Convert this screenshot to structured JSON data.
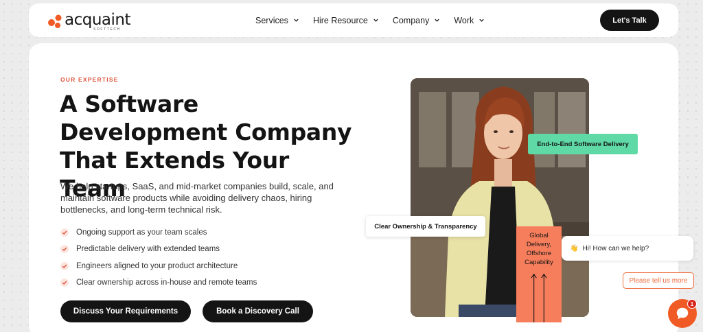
{
  "brand": {
    "name": "acquaint",
    "sub": "SOFTTECH",
    "colors": {
      "accent": "#f05a24",
      "dark": "#141414",
      "green": "#5fd9a6",
      "orange": "#f77e5c"
    }
  },
  "nav": {
    "items": [
      {
        "label": "Services",
        "icon": "chevron-down-icon"
      },
      {
        "label": "Hire Resource",
        "icon": "chevron-down-icon"
      },
      {
        "label": "Company",
        "icon": "chevron-down-icon"
      },
      {
        "label": "Work",
        "icon": "chevron-down-icon"
      }
    ],
    "cta": "Let's Talk"
  },
  "hero": {
    "eyebrow": "OUR EXPERTISE",
    "title": "A Software Development Company That Extends Your Team",
    "description": "We help startups, SaaS, and mid-market companies build, scale, and maintain software products while avoiding delivery chaos, hiring bottlenecks, and long-term technical risk.",
    "bullets": [
      "Ongoing support as your team scales",
      "Predictable delivery with extended teams",
      "Engineers aligned to your product architecture",
      "Clear ownership across in-house and remote teams"
    ],
    "buttons": {
      "primary": "Discuss Your Requirements",
      "secondary": "Book a Discovery Call"
    },
    "tags": {
      "green": "End-to-End Software Delivery",
      "white": "Clear Ownership & Transparency",
      "orange": "Global Delivery, Offshore Capability"
    }
  },
  "chat": {
    "greeting_emoji": "👋",
    "greeting": "Hi! How can we help?",
    "button": "Please tell us more",
    "badge": "1"
  }
}
